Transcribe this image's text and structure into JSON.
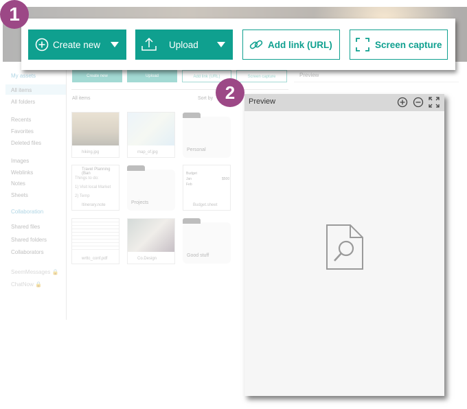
{
  "background": {
    "sidebar": {
      "my_assets": "My assets",
      "all_items": "All items",
      "all_folders": "All folders",
      "recents": "Recents",
      "favorites": "Favorites",
      "deleted_files": "Deleted files",
      "images": "Images",
      "weblinks": "Weblinks",
      "notes": "Notes",
      "sheets": "Sheets",
      "collaboration": "Collaboration",
      "shared_files": "Shared files",
      "shared_folders": "Shared folders",
      "collaborators": "Collaborators",
      "seem_messages": "SeemMessages",
      "chat_now": "ChatNow"
    },
    "toolbar": {
      "create_new": "Create new",
      "upload": "Upload",
      "add_link": "Add link (URL)",
      "screen_capture": "Screen capture"
    },
    "grid": {
      "title": "All items",
      "sort": "Sort by",
      "tiles": [
        "hiking.jpg",
        "map_of.jpg",
        "Itinerary.note",
        "Budget.sheet",
        "wrttc_conf.pdf",
        "Co.Design"
      ],
      "folders": [
        "Personal",
        "Projects",
        "Good stuff"
      ],
      "note_title": "Travel Planning (Ban",
      "note_lines": [
        "Things to do:",
        "1) Visit local Market",
        "2) Temp"
      ],
      "sheet_cells": [
        "Budget",
        "Jan",
        "$500",
        "Feb"
      ]
    },
    "preview_title": "Preview"
  },
  "callout1": {
    "badge": "1",
    "create_new": "Create new",
    "upload": "Upload",
    "add_link": "Add link (URL)",
    "screen_capture": "Screen capture"
  },
  "callout2": {
    "badge": "2",
    "preview_title": "Preview"
  },
  "colors": {
    "accent": "#0fa08f",
    "badge": "#9c4886",
    "link": "#2a8fb8"
  }
}
